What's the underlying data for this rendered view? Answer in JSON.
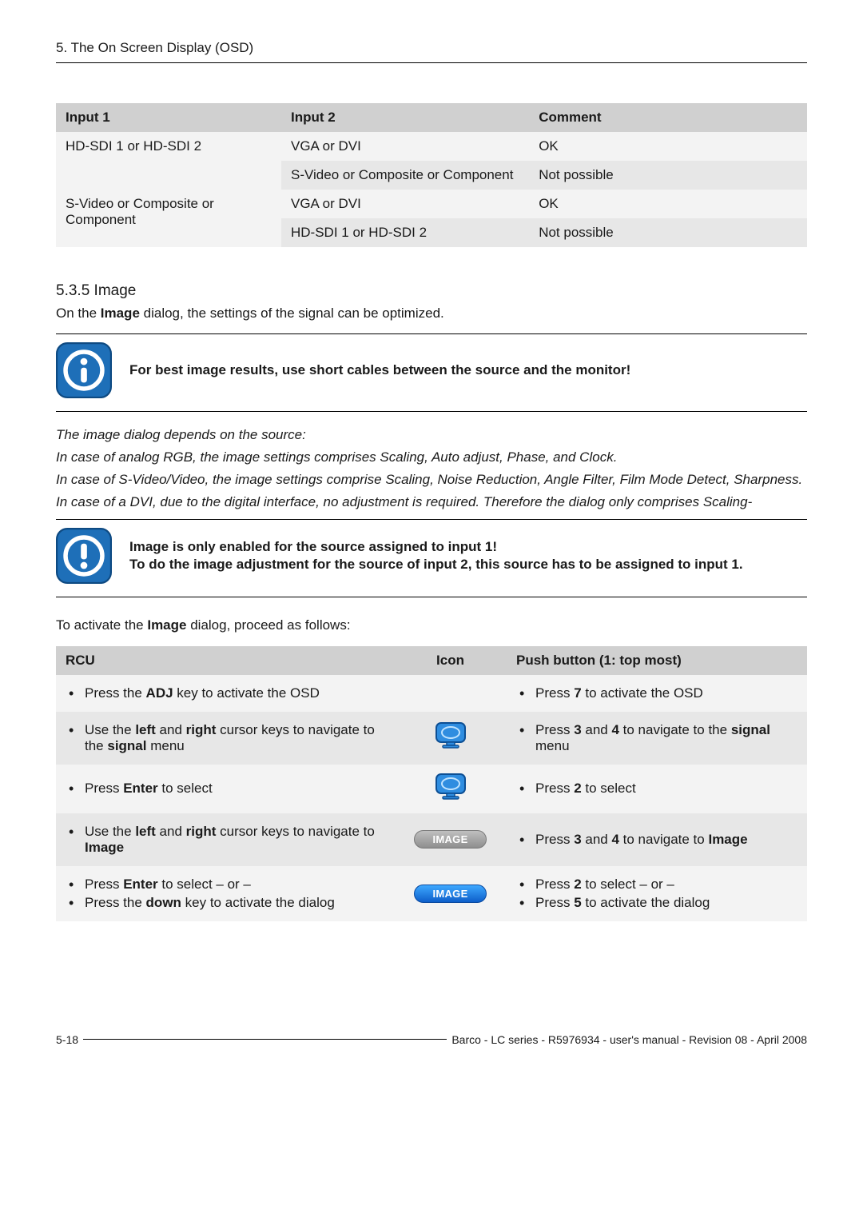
{
  "header": {
    "section": "5. The On Screen Display (OSD)"
  },
  "table1": {
    "headers": [
      "Input 1",
      "Input 2",
      "Comment"
    ],
    "rows": [
      {
        "c1": "HD-SDI 1 or HD-SDI 2",
        "c2": "VGA or DVI",
        "c3": "OK",
        "shade": "light",
        "showC1": true
      },
      {
        "c1": "",
        "c2": "S-Video or Composite or Component",
        "c3": "Not possible",
        "shade": "dark",
        "showC1": false
      },
      {
        "c1": "S-Video or Composite or Component",
        "c2": "VGA or DVI",
        "c3": "OK",
        "shade": "light",
        "showC1": true
      },
      {
        "c1": "",
        "c2": "HD-SDI 1 or HD-SDI 2",
        "c3": "Not possible",
        "shade": "dark",
        "showC1": false
      }
    ]
  },
  "section": {
    "heading": "5.3.5 Image",
    "intro_pre": "On the ",
    "intro_bold": "Image",
    "intro_post": " dialog, the settings of the signal can be optimized."
  },
  "callout_info": {
    "text": "For best image results, use short cables between the source and the monitor!"
  },
  "italic_block": {
    "l1": "The image dialog depends on the source:",
    "l2": "In case of analog RGB, the image settings comprises Scaling, Auto adjust, Phase, and Clock.",
    "l3": "In case of S-Video/Video, the image settings comprise Scaling, Noise Reduction, Angle Filter, Film Mode Detect, Sharpness.",
    "l4": "In case of a DVI, due to the digital interface, no adjustment is required. Therefore the dialog only comprises Scaling-"
  },
  "callout_warn": {
    "l1": "Image is only enabled for the source assigned to input 1!",
    "l2": "To do the image adjustment for the source  of input 2, this source has to be assigned to input 1."
  },
  "activate_pre": "To activate the ",
  "activate_bold": "Image",
  "activate_post": " dialog, proceed as follows:",
  "rcu": {
    "headers": {
      "c1": "RCU",
      "c2": "Icon",
      "c3": "Push button (1: top most)"
    },
    "rows": [
      {
        "left": [
          {
            "pre": "Press the ",
            "b": "ADJ",
            "post": " key to activate the OSD"
          }
        ],
        "icon": "none",
        "right": [
          {
            "pre": "Press ",
            "b": "7",
            "post": " to activate the OSD"
          }
        ],
        "shade": "light"
      },
      {
        "left": [
          {
            "pre": "Use the ",
            "b": "left",
            "mid": " and ",
            "b2": "right",
            "post2": " cursor keys to navigate to the ",
            "b3": "signal",
            "post3": " menu"
          }
        ],
        "icon": "monitor",
        "right": [
          {
            "pre": "Press ",
            "b": "3",
            "mid": " and ",
            "b2": "4",
            "post2": " to navigate to the ",
            "b3": "signal",
            "post3": " menu"
          }
        ],
        "shade": "dark"
      },
      {
        "left": [
          {
            "pre": "Press ",
            "b": "Enter",
            "post": " to select"
          }
        ],
        "icon": "monitor",
        "right": [
          {
            "pre": "Press ",
            "b": "2",
            "post": " to select"
          }
        ],
        "shade": "light"
      },
      {
        "left": [
          {
            "pre": "Use the ",
            "b": "left",
            "mid": " and ",
            "b2": "right",
            "post2": " cursor keys to navigate to ",
            "b3": "Image",
            "post3": ""
          }
        ],
        "icon": "pill-gray",
        "iconText": "IMAGE",
        "right": [
          {
            "pre": "Press ",
            "b": "3",
            "mid": " and ",
            "b2": "4",
            "post2": " to navigate to ",
            "b3": "Image",
            "post3": ""
          }
        ],
        "shade": "dark"
      },
      {
        "left": [
          {
            "pre": "Press ",
            "b": "Enter",
            "post": " to select – or –"
          },
          {
            "pre": "Press the ",
            "b": "down",
            "post": " key to activate the dialog"
          }
        ],
        "icon": "pill-blue",
        "iconText": "IMAGE",
        "right": [
          {
            "pre": "Press ",
            "b": "2",
            "post": " to select – or –"
          },
          {
            "pre": "Press ",
            "b": "5",
            "post": " to activate the dialog"
          }
        ],
        "shade": "light"
      }
    ]
  },
  "footer": {
    "page": "5-18",
    "text": "Barco - LC series - R5976934 - user's manual - Revision 08 - April 2008"
  }
}
